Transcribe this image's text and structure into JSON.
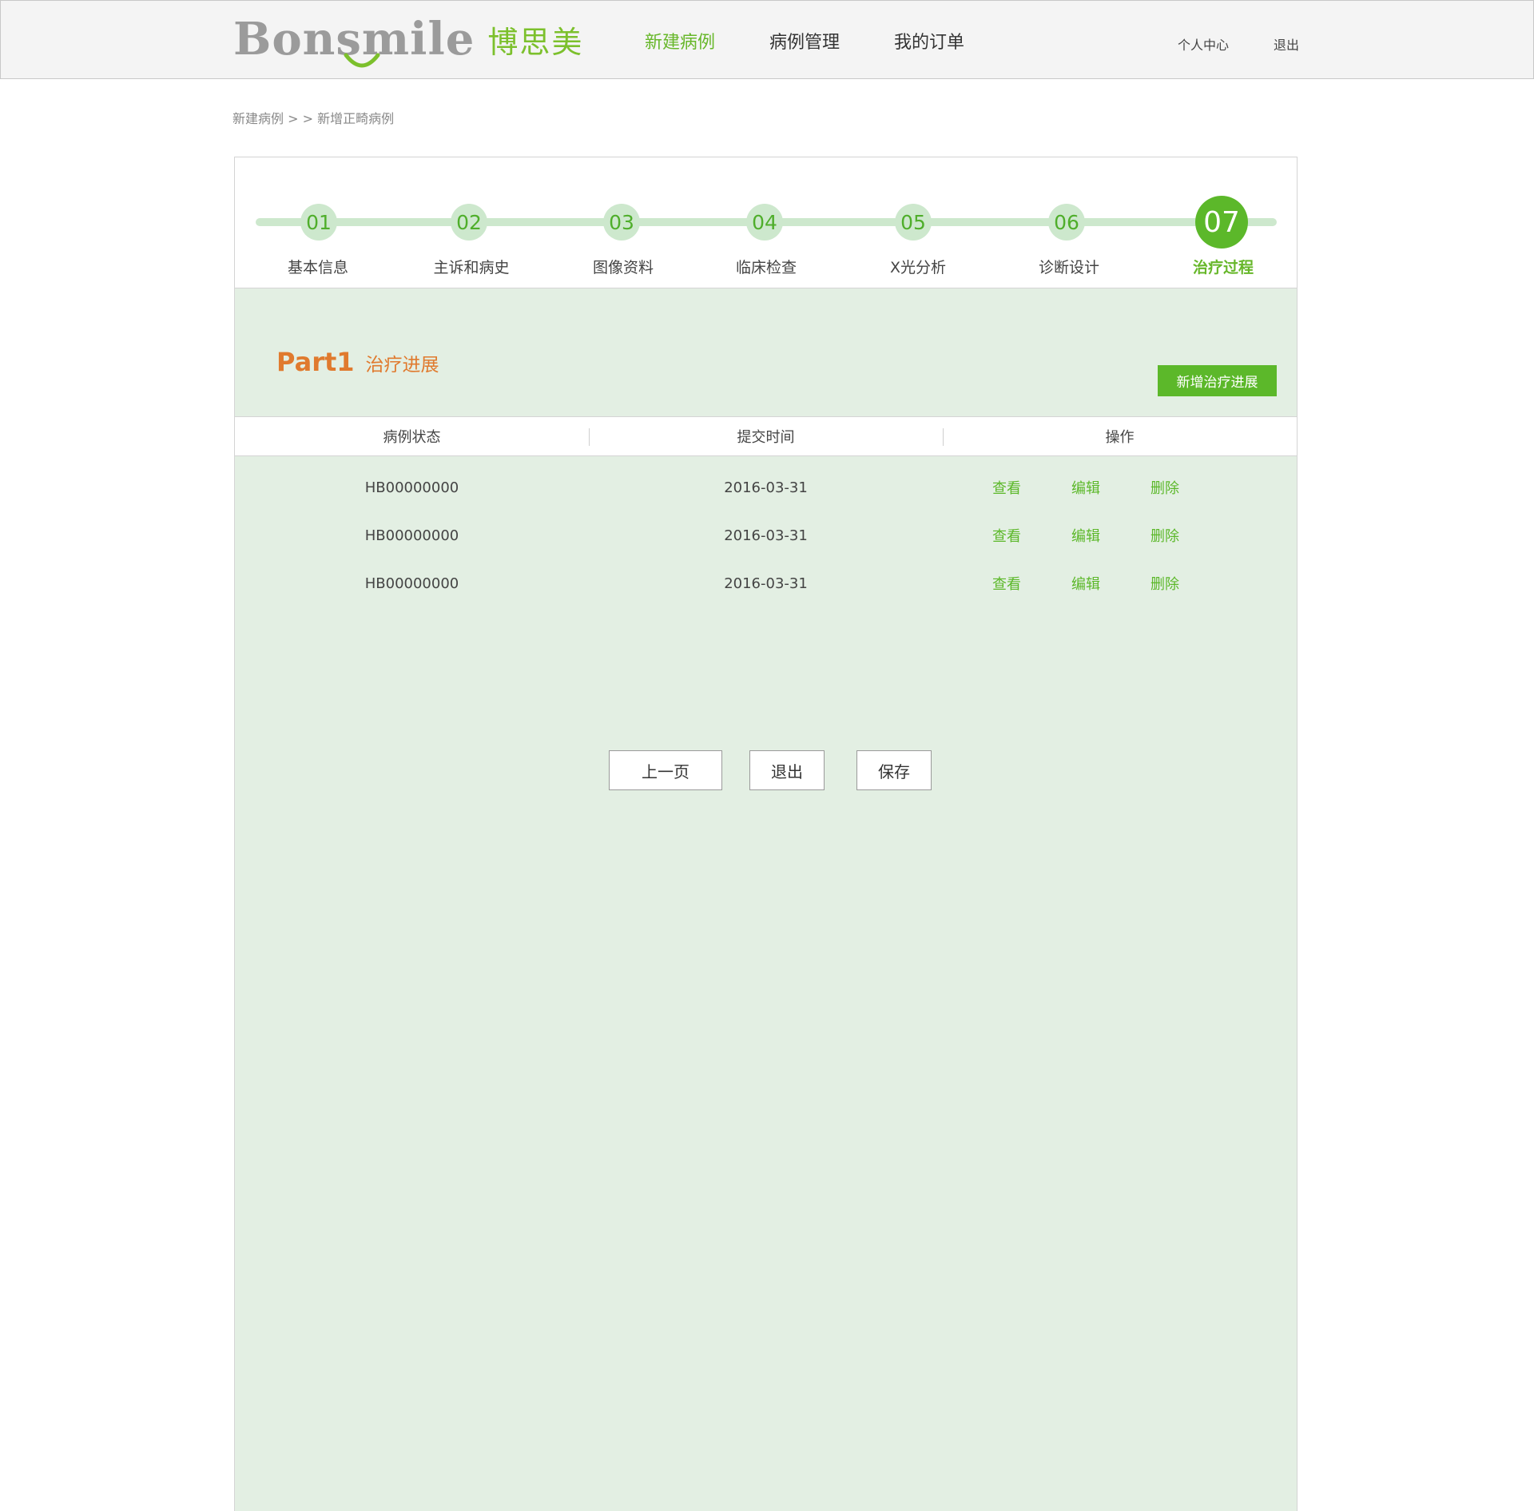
{
  "header": {
    "logo_text": "Bonsmile",
    "logo_cn": "博思美",
    "nav": [
      {
        "label": "新建病例",
        "active": true
      },
      {
        "label": "病例管理",
        "active": false
      },
      {
        "label": "我的订单",
        "active": false
      }
    ],
    "user_links": [
      "个人中心",
      "退出"
    ]
  },
  "breadcrumb": "新建病例 > > 新增正畸病例",
  "steps": [
    {
      "num": "01",
      "label": "基本信息",
      "active": false
    },
    {
      "num": "02",
      "label": "主诉和病史",
      "active": false
    },
    {
      "num": "03",
      "label": "图像资料",
      "active": false
    },
    {
      "num": "04",
      "label": "临床检查",
      "active": false
    },
    {
      "num": "05",
      "label": "X光分析",
      "active": false
    },
    {
      "num": "06",
      "label": "诊断设计",
      "active": false
    },
    {
      "num": "07",
      "label": "治疗过程",
      "active": true
    }
  ],
  "part": {
    "num": "Part1",
    "title": "治疗进展",
    "add_button": "新增治疗进展"
  },
  "table": {
    "headers": [
      "病例状态",
      "提交时间",
      "操作"
    ],
    "rows": [
      {
        "status": "HB00000000",
        "time": "2016-03-31"
      },
      {
        "status": "HB00000000",
        "time": "2016-03-31"
      },
      {
        "status": "HB00000000",
        "time": "2016-03-31"
      }
    ],
    "actions": [
      "查看",
      "编辑",
      "删除"
    ]
  },
  "buttons": {
    "prev": "上一页",
    "exit": "退出",
    "save": "保存"
  },
  "colors": {
    "brand_green": "#5cb82a",
    "accent_orange": "#e07a2e",
    "panel_bg": "#e3efe3"
  }
}
